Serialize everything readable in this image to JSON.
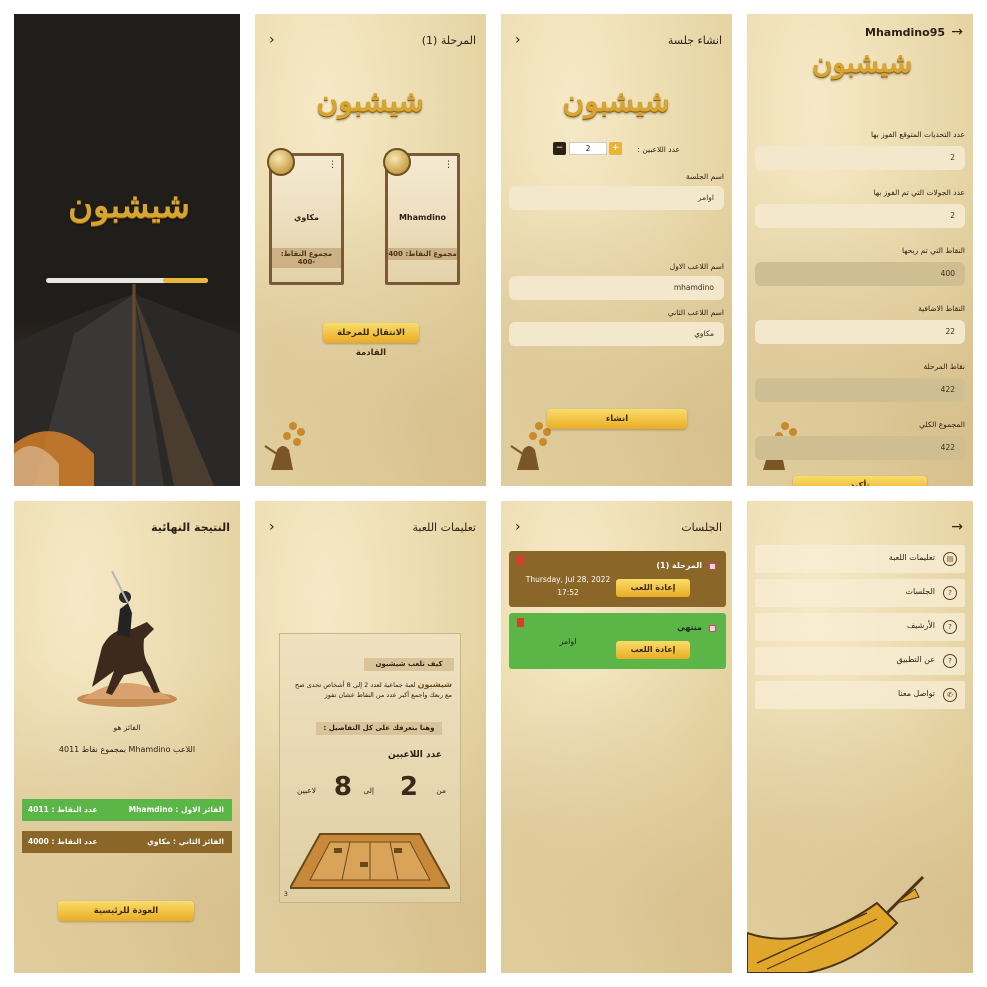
{
  "splash": {
    "logo": "شيشبون",
    "progress": 0.72
  },
  "stage_screen": {
    "title": "المرحلة (1)",
    "logo": "شيشبون",
    "players": [
      {
        "name": "Mhamdino",
        "points_label": "مجموع النقاط: 400"
      },
      {
        "name": "مكاوي",
        "points_label": "مجموع النقاط: -400"
      }
    ],
    "next_button": "الانتقال للمرحلة القادمة"
  },
  "create_session": {
    "title": "انشاء جلسة",
    "logo": "شيشبون",
    "players_count_label": "عدد اللاعبين :",
    "players_count": "2",
    "minus": "−",
    "plus": "+",
    "session_name_label": "اسم الجلسة",
    "session_name_value": "اوامر",
    "player1_label": "اسم اللاعب الاول",
    "player1_value": "mhamdino",
    "player2_label": "اسم اللاعب الثاني",
    "player2_value": "مكاوي",
    "create_button": "انشاء"
  },
  "player_stats": {
    "username": "Mhamdino95",
    "logo": "شيشبون",
    "fields": [
      {
        "label": "عدد التحديات المتوقع الفوز بها",
        "value": "2"
      },
      {
        "label": "عدد الجولات التي تم الفوز بها",
        "value": "2"
      },
      {
        "label": "النقاط التي تم ربحها",
        "value": "400"
      },
      {
        "label": "النقاط الاضافية",
        "value": "22"
      },
      {
        "label": "نقاط المرحلة",
        "value": "422"
      },
      {
        "label": "المجموع الكلي",
        "value": "422"
      }
    ],
    "confirm_button": "تأكيد"
  },
  "final_result": {
    "title": "النتيجة النهائية",
    "winner_is": "الفائز هو",
    "winner_text": "اللاعب Mhamdino بمجموع نقاط 4011",
    "first": {
      "label": "الفائز الاول : Mhamdino",
      "points": "عدد النقاط : 4011"
    },
    "second": {
      "label": "الفائز الثاني : مكاوي",
      "points": "عدد النقاط : 4000"
    },
    "home_button": "العودة للرئيسية"
  },
  "instructions": {
    "title": "تعليمات اللعبة",
    "banner1": "كيف تلعب شيشبون",
    "body_brand": "شيشبون",
    "body": "لعبة جماعية لعدد 2 إلى 8 أشخاص تحدى صح مع ربعك واجمع أكبر عدد من النقاط عشان تفوز",
    "banner2": "وهنا بنعرفك على كل التفاصيل :",
    "players_heading": "عدد اللاعبين",
    "from": "من",
    "min": "2",
    "to": "إلى",
    "max": "8",
    "players_word": "لاعبين",
    "page_num": "3"
  },
  "sessions": {
    "title": "الجلسات",
    "items": [
      {
        "title": "المرحلة (1)",
        "date": "Thursday, Jul 28, 2022",
        "time": "17:52",
        "button": "إعادة اللعب"
      },
      {
        "title": "منتهي",
        "name": "اوامر",
        "button": "إعادة اللعب"
      }
    ]
  },
  "menu": {
    "items": [
      {
        "label": "تعليمات اللعبة",
        "icon": "document-icon",
        "glyph": "▤"
      },
      {
        "label": "الجلسات",
        "icon": "help-icon",
        "glyph": "?"
      },
      {
        "label": "الأرشيف",
        "icon": "help-icon",
        "glyph": "?"
      },
      {
        "label": "عن التطبيق",
        "icon": "help-icon",
        "glyph": "?"
      },
      {
        "label": "تواصل معنا",
        "icon": "phone-icon",
        "glyph": "✆"
      }
    ]
  },
  "colors": {
    "gold": "#e9b43a",
    "brown": "#8a6628",
    "green": "#5cb547",
    "parchment": "#ecdcb0"
  }
}
